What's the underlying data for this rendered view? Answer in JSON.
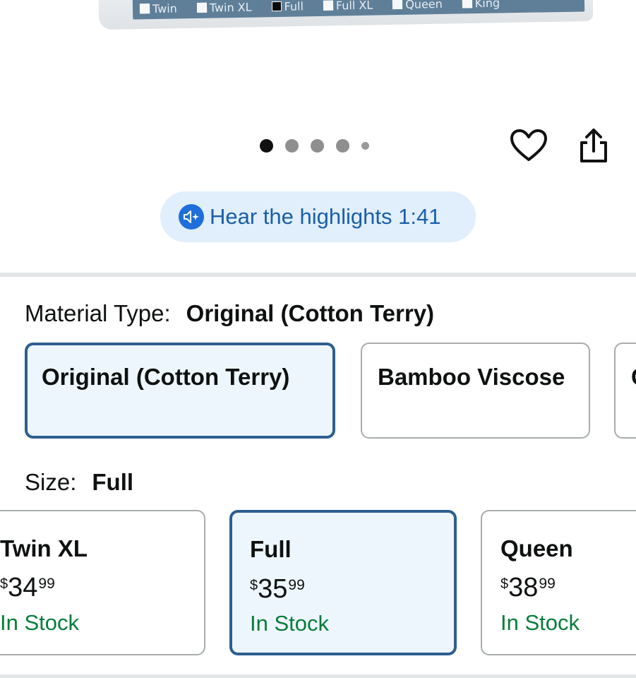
{
  "product_image": {
    "size_strip": [
      {
        "label": "Twin",
        "checked": false
      },
      {
        "label": "Twin XL",
        "checked": false
      },
      {
        "label": "Full",
        "checked": true
      },
      {
        "label": "Full XL",
        "checked": false
      },
      {
        "label": "Queen",
        "checked": false
      },
      {
        "label": "King",
        "checked": false
      }
    ]
  },
  "carousel": {
    "dot_count": 5,
    "active_index": 0
  },
  "actions": {
    "wishlist_icon": "heart-icon",
    "share_icon": "share-icon"
  },
  "highlights": {
    "label": "Hear the highlights 1:41",
    "icon": "speaker-sparkle-icon"
  },
  "material": {
    "label": "Material Type:",
    "selected": "Original (Cotton Terry)",
    "options": [
      {
        "title": "Original (Cotton Terry)",
        "selected": true
      },
      {
        "title": "Bamboo Viscose",
        "selected": false
      },
      {
        "title": "C",
        "selected": false
      }
    ]
  },
  "size": {
    "label": "Size:",
    "selected": "Full",
    "options": [
      {
        "title": "Twin XL",
        "currency": "$",
        "whole": "34",
        "fraction": "99",
        "stock": "In Stock",
        "selected": false
      },
      {
        "title": "Full",
        "currency": "$",
        "whole": "35",
        "fraction": "99",
        "stock": "In Stock",
        "selected": true
      },
      {
        "title": "Queen",
        "currency": "$",
        "whole": "38",
        "fraction": "99",
        "stock": "In Stock",
        "selected": false
      }
    ]
  },
  "colors": {
    "accent_blue": "#2d5f8f",
    "pill_bg": "#e1eefc",
    "in_stock_green": "#067d3a"
  }
}
